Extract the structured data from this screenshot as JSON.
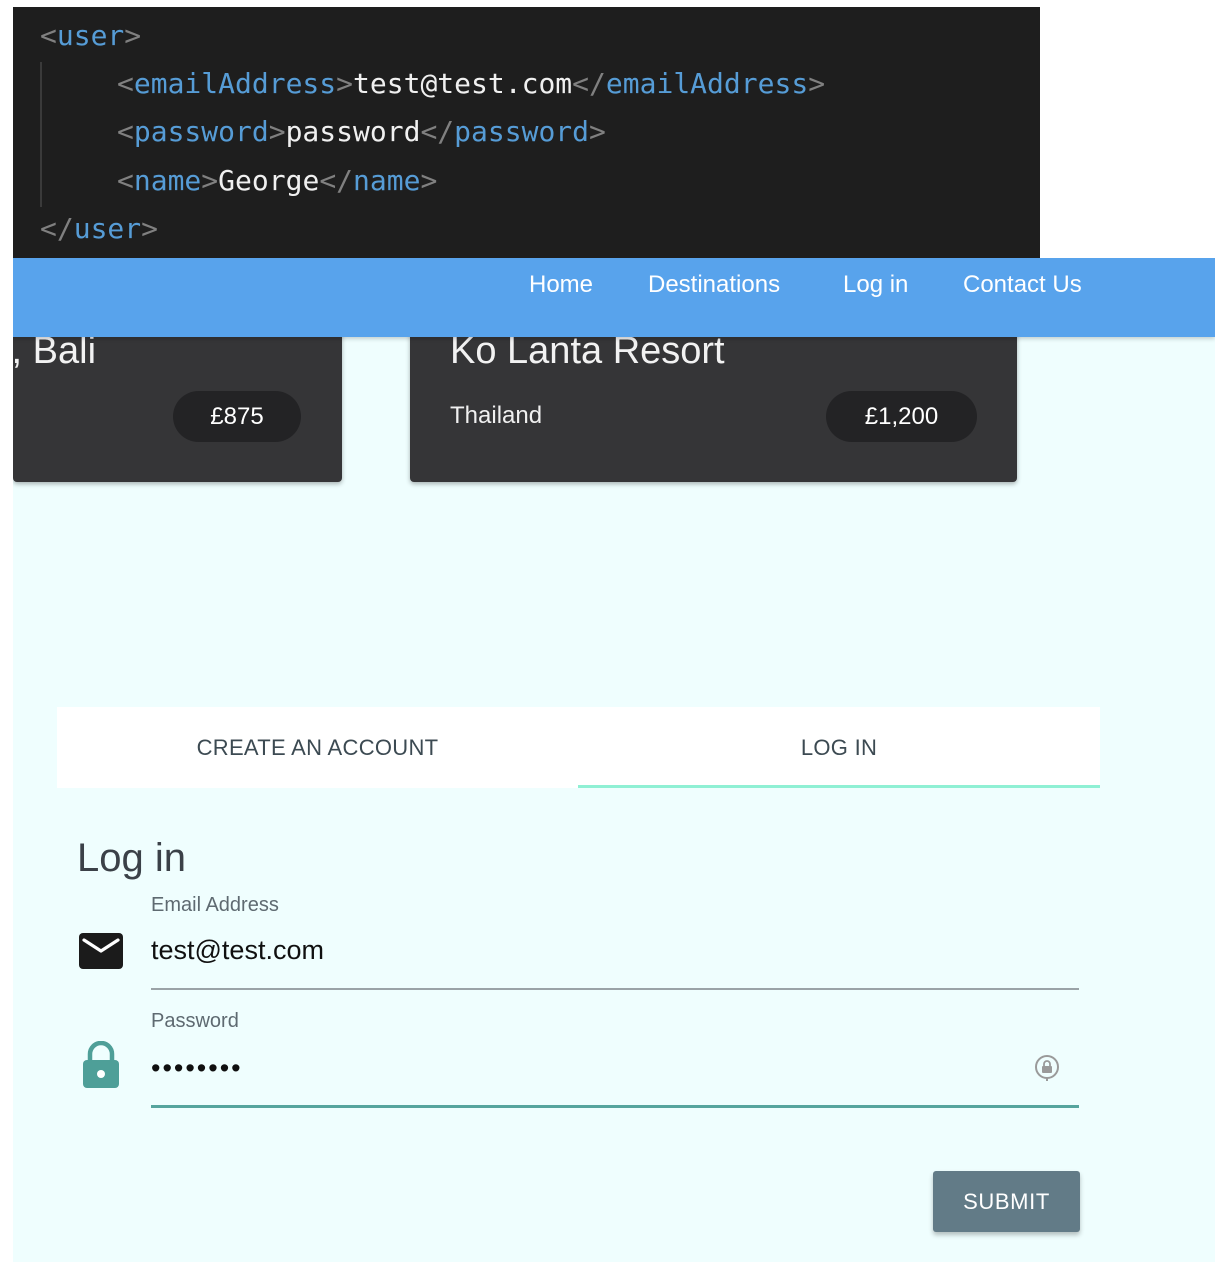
{
  "code_snippet": {
    "open_tag": "user",
    "email_tag": "emailAddress",
    "email_value": "test@test.com",
    "password_tag": "password",
    "password_value": "password",
    "name_tag": "name",
    "name_value": "George",
    "close_tag": "user"
  },
  "nav": {
    "home": "Home",
    "destinations": "Destinations",
    "login": "Log in",
    "contact": "Contact Us",
    "background": "#58a3ec"
  },
  "cards": [
    {
      "title": "t, Bali",
      "country": "",
      "price": "£875"
    },
    {
      "title": "Ko Lanta Resort",
      "country": "Thailand",
      "price": "£1,200"
    }
  ],
  "tabs": {
    "create": "CREATE AN ACCOUNT",
    "login": "LOG IN",
    "active": "login",
    "indicator_color": "#8ff0d4"
  },
  "login_form": {
    "title": "Log in",
    "email_label": "Email Address",
    "email_value": "test@test.com",
    "email_icon": "mail-icon",
    "password_label": "Password",
    "password_value": "password",
    "password_icon": "lock-icon",
    "password_manager_icon": "password-manager-key-icon",
    "submit": "SUBMIT",
    "accent": "#56a59e",
    "submit_color": "#627b87"
  }
}
